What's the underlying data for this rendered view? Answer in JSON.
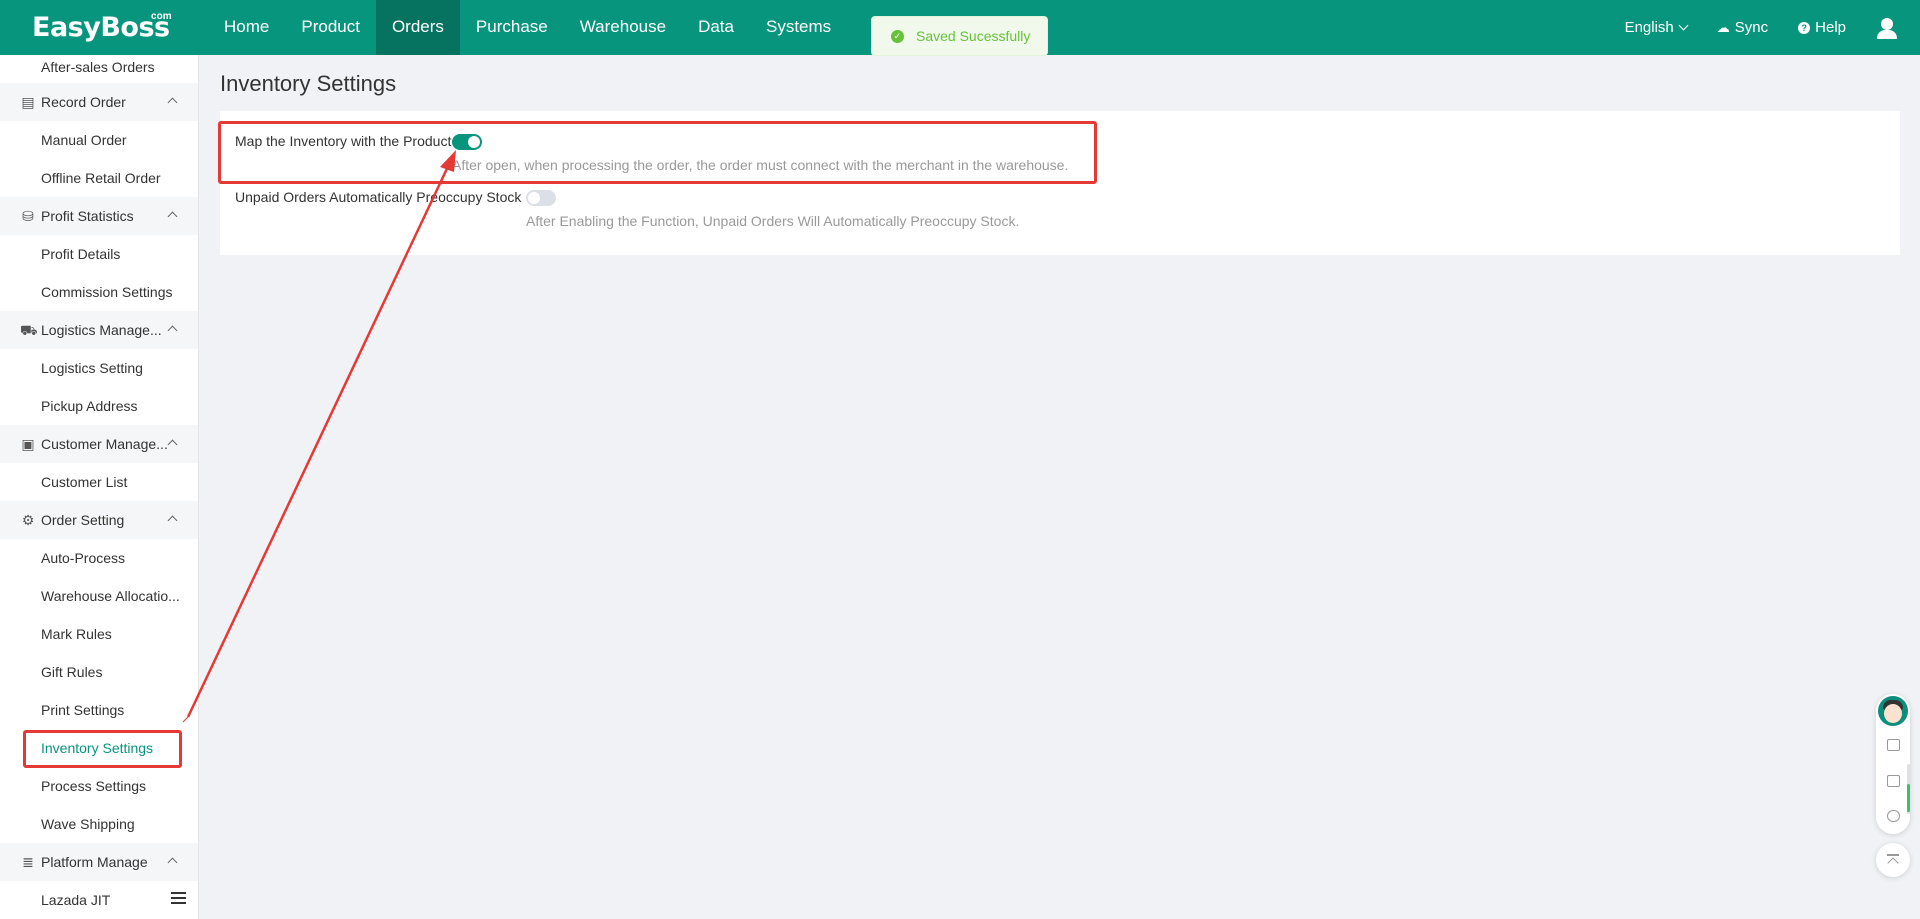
{
  "brand": {
    "name": "EasyBoss",
    "suffix": "com"
  },
  "nav": {
    "items": [
      {
        "label": "Home"
      },
      {
        "label": "Product"
      },
      {
        "label": "Orders"
      },
      {
        "label": "Purchase"
      },
      {
        "label": "Warehouse"
      },
      {
        "label": "Data"
      },
      {
        "label": "Systems"
      }
    ],
    "active": "Orders"
  },
  "toast": {
    "message": "Saved Sucessfully",
    "color": "#67c23a"
  },
  "header_right": {
    "language": "English",
    "sync_label": "Sync",
    "help_label": "Help"
  },
  "sidebar": {
    "top_item": "After-sales Orders",
    "groups": [
      {
        "label": "Record Order",
        "items": [
          "Manual Order",
          "Offline Retail Order"
        ]
      },
      {
        "label": "Profit Statistics",
        "items": [
          "Profit Details",
          "Commission Settings"
        ]
      },
      {
        "label": "Logistics Manage...",
        "items": [
          "Logistics Setting",
          "Pickup Address"
        ]
      },
      {
        "label": "Customer Manage...",
        "items": [
          "Customer List"
        ]
      },
      {
        "label": "Order Setting",
        "items": [
          "Auto-Process",
          "Warehouse Allocatio...",
          "Mark Rules",
          "Gift Rules",
          "Print Settings",
          "Inventory Settings",
          "Process Settings",
          "Wave Shipping"
        ]
      },
      {
        "label": "Platform Manage",
        "items": [
          "Lazada JIT"
        ]
      }
    ],
    "active_item": "Inventory Settings"
  },
  "main": {
    "title": "Inventory Settings",
    "settings": [
      {
        "label": "Map the Inventory with the Product",
        "enabled": true,
        "description": "After open, when processing the order, the order must connect with the merchant in the warehouse."
      },
      {
        "label": "Unpaid Orders Automatically Preoccupy Stock",
        "enabled": false,
        "description": "After Enabling the Function, Unpaid Orders Will Automatically Preoccupy Stock."
      }
    ]
  },
  "colors": {
    "primary": "#08957e",
    "nav_active": "#067361",
    "annotation": "#e53935"
  }
}
